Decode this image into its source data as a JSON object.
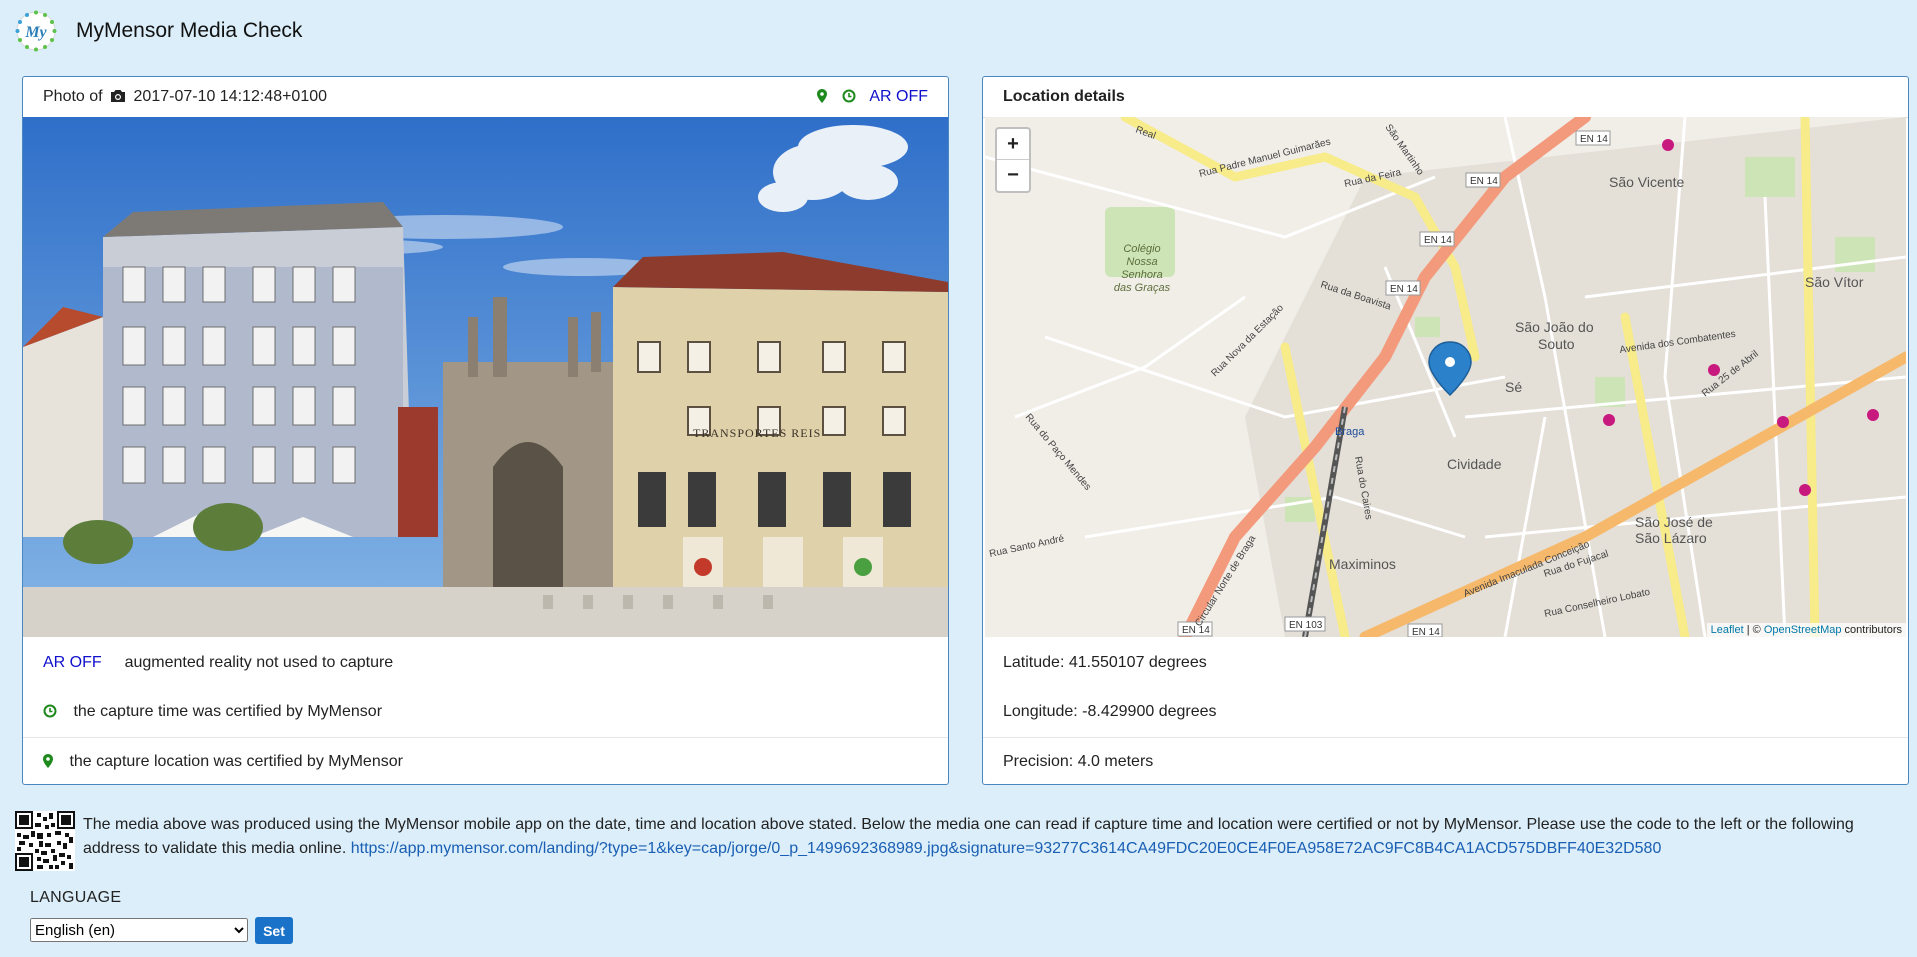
{
  "header": {
    "title": "MyMensor Media Check",
    "logo_text": "My"
  },
  "photo_panel": {
    "title_prefix": "Photo of",
    "datetime": "2017-07-10 14:12:48+0100",
    "ar_status": "AR OFF",
    "rows": {
      "ar_label": "AR OFF",
      "ar_text": "augmented reality not used to capture",
      "time_text": "the capture time was certified by MyMensor",
      "location_text": "the capture location was certified by MyMensor"
    },
    "street_sign": "TRANSPORTES REIS"
  },
  "location_panel": {
    "title": "Location details",
    "latitude": "Latitude: 41.550107 degrees",
    "longitude": "Longitude: -8.429900 degrees",
    "precision": "Precision: 4.0 meters",
    "zoom_in": "+",
    "zoom_out": "−",
    "attribution_leaflet": "Leaflet",
    "attribution_sep": " | © ",
    "attribution_osm": "OpenStreetMap",
    "attribution_suffix": " contributors",
    "map_labels": {
      "sao_vicente": "São Vicente",
      "sao_vitor": "São Vítor",
      "sao_joao_souto_1": "São João do",
      "sao_joao_souto_2": "Souto",
      "se": "Sé",
      "cividade": "Cividade",
      "maximinos": "Maximinos",
      "sao_jose_1": "São José de",
      "sao_jose_2": "São Lázaro",
      "braga": "Braga",
      "colegio_1": "Colégio",
      "colegio_2": "Nossa",
      "colegio_3": "Senhora",
      "colegio_4": "das Graças",
      "en14": "EN 14",
      "en103": "EN 103",
      "rua_feira": "Rua da Feira",
      "circular_norte": "Circular Norte de Braga",
      "avenida_imaculada": "Avenida Imaculada Conceição",
      "rua_caires": "Rua do Caires",
      "avenida_combatentes": "Avenida dos Combatentes",
      "rua_25_abril": "Rua 25 de Abril",
      "rua_padre_manuel": "Rua Padre Manuel Guimarães",
      "rua_boavista": "Rua da Boavista",
      "rua_santo_andre": "Rua Santo André",
      "rua_conselheiro": "Rua Conselheiro Lobato",
      "rua_fujacal": "Rua do Fujacal",
      "rua_real": "Real",
      "rua_martinho": "São Martinho",
      "rua_paulo_mendes": "Rua do Paço Mendes",
      "rua_estacao": "Rua Nova da Estação"
    }
  },
  "footer": {
    "note": "The media above was produced using the MyMensor mobile app on the date, time and location above stated. Below the media one can read if capture time and location were certified or not by MyMensor. Please use the code to the left or the following address to validate this media online.",
    "link": "https://app.mymensor.com/landing/?type=1&key=cap/jorge/0_p_1499692368989.jpg&signature=93277C3614CA49FDC20E0CE4F0EA958E72AC9FC8B4CA1ACD575DBFF40E32D580",
    "language_label": "LANGUAGE",
    "language_selected": "English (en)",
    "set_button": "Set"
  },
  "colors": {
    "background": "#dbeef9",
    "panel_border": "#4a87c1",
    "certified_green": "#1e8a1e",
    "ar_blue": "#1010cc",
    "link": "#1a5fb4",
    "button": "#1a73c9"
  }
}
